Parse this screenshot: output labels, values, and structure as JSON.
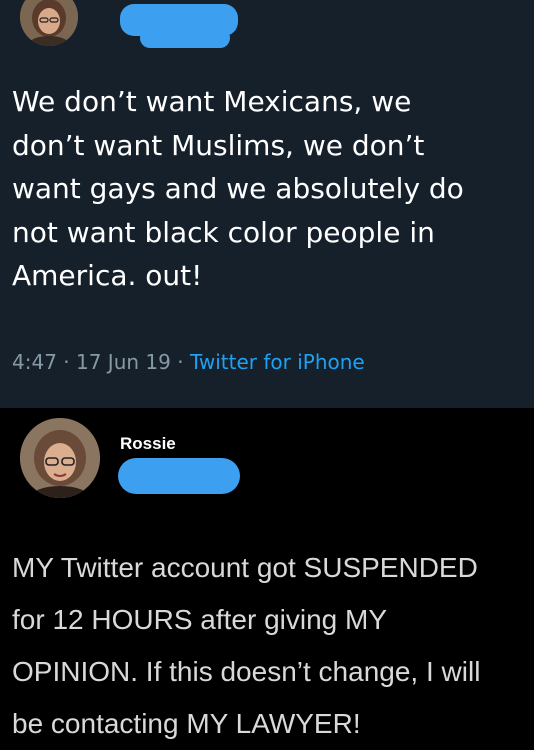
{
  "tweet": {
    "text": "We don’t want Mexicans, we\ndon’t want Muslims, we don’t\nwant gays and we absolutely do\nnot want black color people in\nAmerica. out!",
    "time": "4:47",
    "date": "17 Jun 19",
    "separator": "·",
    "source": "Twitter for iPhone",
    "avatar_icon": "profile-photo",
    "handle_redaction_color": "#3c9ff0"
  },
  "post": {
    "author_name": "Rossie",
    "text": "MY Twitter account got SUSPENDED\nfor 12 HOURS after giving MY\nOPINION. If this doesn’t change, I will\nbe contacting MY LAWYER!",
    "avatar_icon": "profile-photo"
  },
  "colors": {
    "tweet_background": "#15202b",
    "post_background": "#000000",
    "link": "#1da1f2",
    "meta": "#8899a6"
  }
}
